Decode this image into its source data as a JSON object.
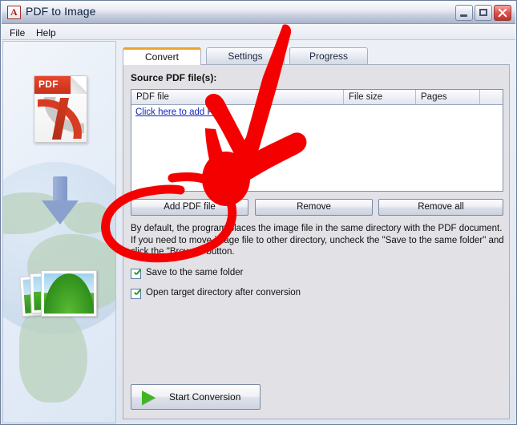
{
  "window": {
    "title": "PDF to Image",
    "icon": "pdf-app-icon",
    "controls": {
      "minimize": "minimize-button",
      "maximize": "maximize-button",
      "close": "close-button"
    }
  },
  "menubar": {
    "items": [
      {
        "label": "File"
      },
      {
        "label": "Help"
      }
    ]
  },
  "sidebar": {
    "graphics": [
      {
        "name": "pdf-document-icon",
        "label": "PDF"
      },
      {
        "name": "down-arrow-icon"
      },
      {
        "name": "image-stack-icon"
      },
      {
        "name": "globe-watermark"
      }
    ]
  },
  "tabs": [
    {
      "label": "Convert",
      "active": true
    },
    {
      "label": "Settings",
      "active": false
    },
    {
      "label": "Progress",
      "active": false
    }
  ],
  "convert": {
    "source_label": "Source PDF file(s):",
    "list": {
      "columns": [
        "PDF file",
        "File size",
        "Pages",
        ""
      ],
      "rows": [],
      "empty_link": "Click here to add PDF"
    },
    "buttons": {
      "add": "Add PDF file",
      "remove": "Remove",
      "remove_all": "Remove all"
    },
    "description": "By default, the program places the image file in the same directory with the PDF document. If you need to move image file to other directory, uncheck the \"Save to the same folder\" and click the \"Browse\" button.",
    "checkboxes": [
      {
        "label": "Save to the same folder",
        "checked": true
      },
      {
        "label": "Open target directory after conversion",
        "checked": true
      }
    ],
    "start_button": "Start Conversion"
  },
  "annotations": {
    "arrow": {
      "name": "red-arrow-annotation",
      "points_to": "Add PDF file"
    },
    "circle": {
      "name": "red-circle-annotation",
      "encircles": "Add PDF file"
    },
    "color": "#f50000"
  },
  "colors": {
    "accent_tab": "#efa32c",
    "panel_bg": "#e1e1e6",
    "annotation_red": "#f50000",
    "link": "#1326bb",
    "check_green": "#1f9d28"
  }
}
